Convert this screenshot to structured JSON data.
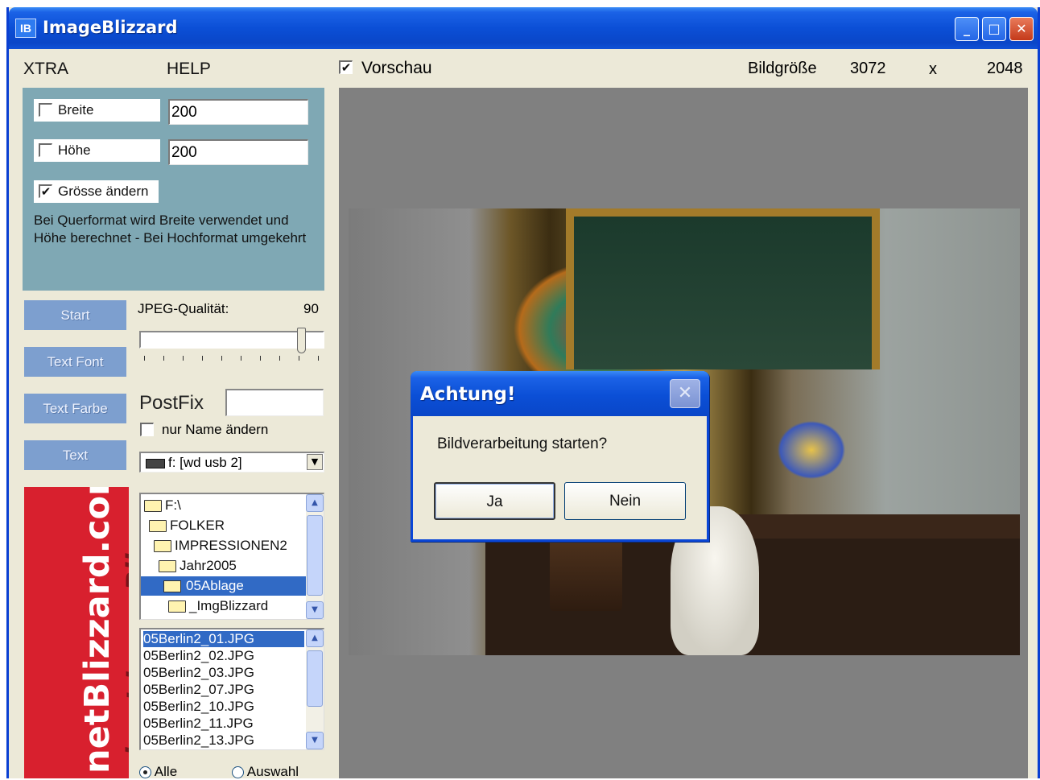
{
  "window": {
    "icon_text": "IB",
    "title": "ImageBlizzard",
    "min_glyph": "_",
    "max_glyph": "□",
    "close_glyph": "✕"
  },
  "menu": {
    "xtra": "XTRA",
    "help": "HELP"
  },
  "header": {
    "preview_label": "Vorschau",
    "preview_checked": true,
    "size_label": "Bildgröße",
    "width": "3072",
    "x": "x",
    "height": "2048"
  },
  "resize": {
    "breite_label": "Breite",
    "breite_value": "200",
    "hoehe_label": "Höhe",
    "hoehe_value": "200",
    "groesse_label": "Grösse ändern",
    "info": "Bei Querformat wird Breite verwendet und Höhe berechnet - Bei Hochformat umgekehrt"
  },
  "buttons": {
    "start": "Start",
    "text_font": "Text Font",
    "text_farbe": "Text Farbe",
    "text": "Text"
  },
  "jpeg": {
    "label": "JPEG-Qualität:",
    "value": "90",
    "level_percent": 90
  },
  "postfix": {
    "label": "PostFix",
    "value": "",
    "nur_name_label": "nur Name ändern"
  },
  "drive": {
    "selected": "f: [wd usb 2]"
  },
  "banner": {
    "line1": "netBlizzard.com",
    "line2": "about ImageBlizzard"
  },
  "folders": [
    {
      "label": "F:\\"
    },
    {
      "label": "FOLKER"
    },
    {
      "label": "IMPRESSIONEN2"
    },
    {
      "label": "Jahr2005"
    },
    {
      "label": "05Ablage"
    },
    {
      "label": "_ImgBlizzard"
    }
  ],
  "files": [
    {
      "label": "05Berlin2_01.JPG"
    },
    {
      "label": "05Berlin2_02.JPG"
    },
    {
      "label": "05Berlin2_03.JPG"
    },
    {
      "label": "05Berlin2_07.JPG"
    },
    {
      "label": "05Berlin2_10.JPG"
    },
    {
      "label": "05Berlin2_11.JPG"
    },
    {
      "label": "05Berlin2_13.JPG"
    }
  ],
  "selection": {
    "alle": "Alle",
    "auswahl": "Auswahl"
  },
  "dialog": {
    "title": "Achtung!",
    "message": "Bildverarbeitung starten?",
    "yes": "Ja",
    "no": "Nein",
    "close_glyph": "✕"
  },
  "colors": {
    "titlebar": "#0b4fd6",
    "panel": "#7fa8b4",
    "side_button": "#7d9fcf",
    "banner": "#d8202e",
    "selection": "#316ac5"
  }
}
